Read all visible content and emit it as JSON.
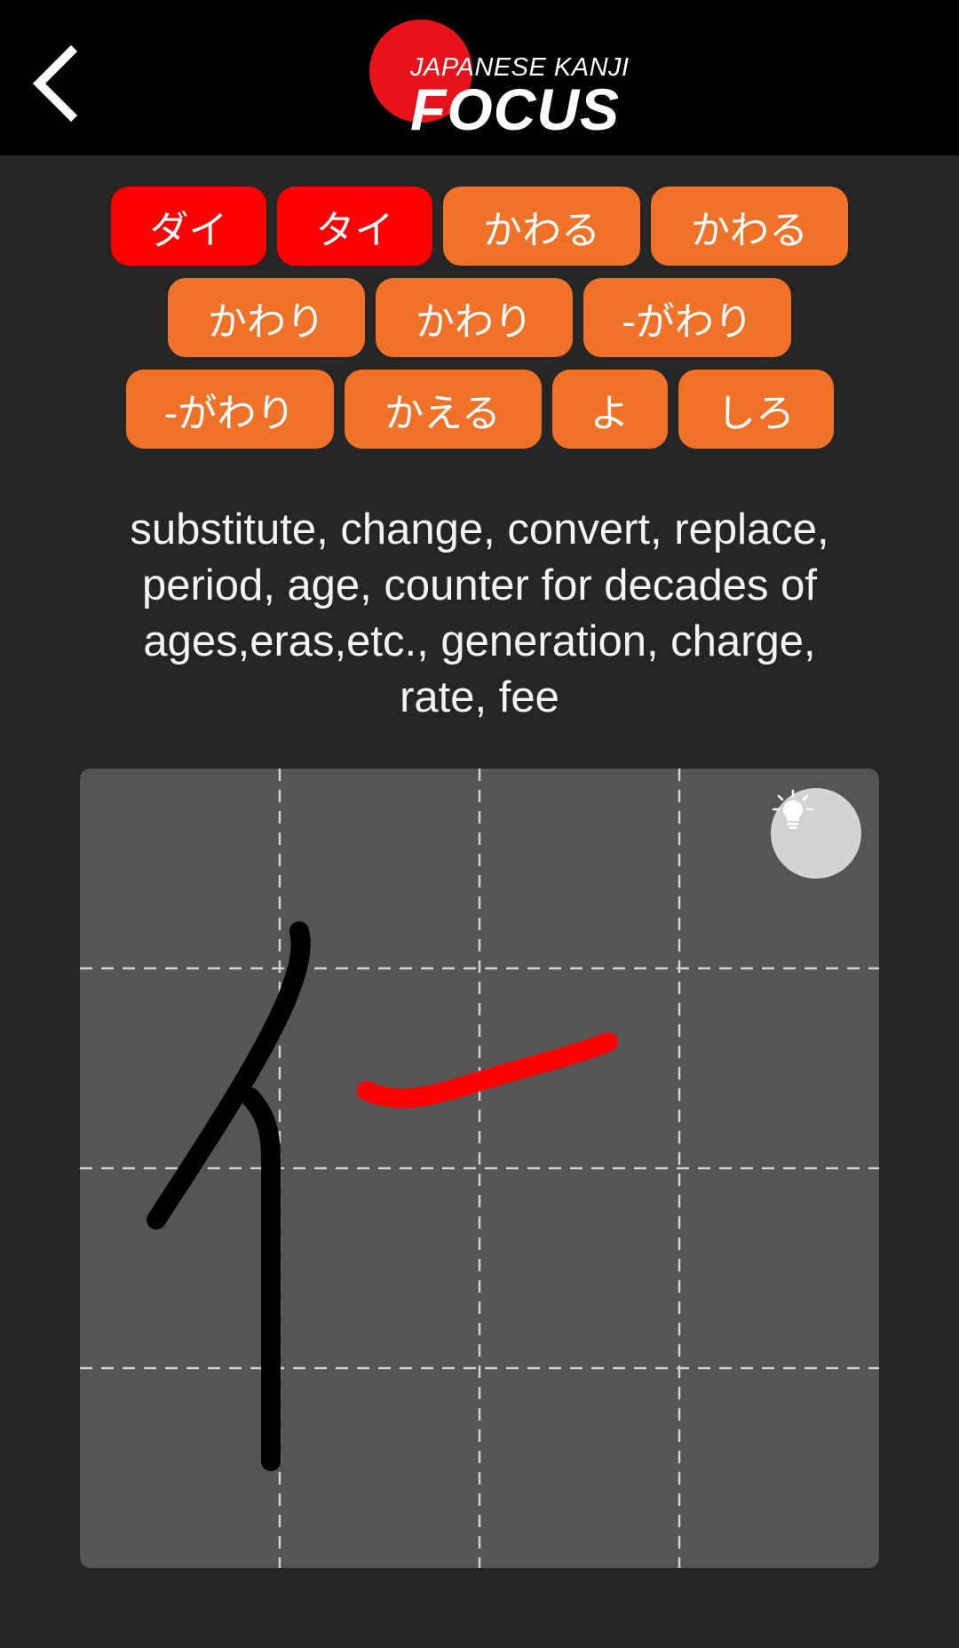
{
  "header": {
    "back_icon": "chevron-left-icon",
    "logo_line1": "JAPANESE KANJI",
    "logo_line2": "FOCUS"
  },
  "readings": [
    {
      "label": "ダイ",
      "active": true
    },
    {
      "label": "タイ",
      "active": true
    },
    {
      "label": "かわる",
      "active": false
    },
    {
      "label": "かわる",
      "active": false
    },
    {
      "label": "かわり",
      "active": false
    },
    {
      "label": "かわり",
      "active": false
    },
    {
      "label": "-がわり",
      "active": false
    },
    {
      "label": "-がわり",
      "active": false
    },
    {
      "label": "かえる",
      "active": false
    },
    {
      "label": "よ",
      "active": false
    },
    {
      "label": "しろ",
      "active": false
    }
  ],
  "meaning_lines": [
    "substitute, change, convert, replace,",
    "period, age, counter for decades of",
    "ages,eras,etc., generation, charge,",
    "rate, fee"
  ],
  "drawing": {
    "hint_icon": "lightbulb-icon",
    "user_stroke_color": "#000000",
    "hint_stroke_color": "#ff0000",
    "grid": "4x4 dashed"
  },
  "colors": {
    "reading_chip": "#f07128",
    "reading_chip_active": "#ff0000",
    "logo_sun": "#e8131a"
  }
}
